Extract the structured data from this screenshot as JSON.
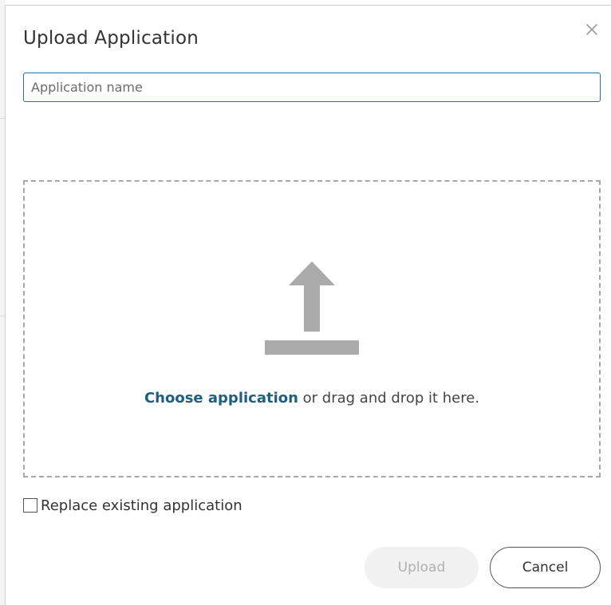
{
  "dialog": {
    "title": "Upload Application",
    "close_icon": "close-icon"
  },
  "name_field": {
    "placeholder": "Application name",
    "value": ""
  },
  "dropzone": {
    "icon": "upload-arrow-icon",
    "choose_link": "Choose application",
    "drop_text": " or drag and drop it here."
  },
  "replace": {
    "label": "Replace existing application",
    "checked": false
  },
  "buttons": {
    "upload_label": "Upload",
    "upload_disabled": true,
    "cancel_label": "Cancel"
  },
  "colors": {
    "accent": "#1f5f7e",
    "input_border": "#2c6e8f",
    "dashed_border": "#a8a8a8",
    "icon_gray": "#aaaaaa",
    "disabled_bg": "#f1f1f1",
    "disabled_text": "#b0b0b0"
  }
}
